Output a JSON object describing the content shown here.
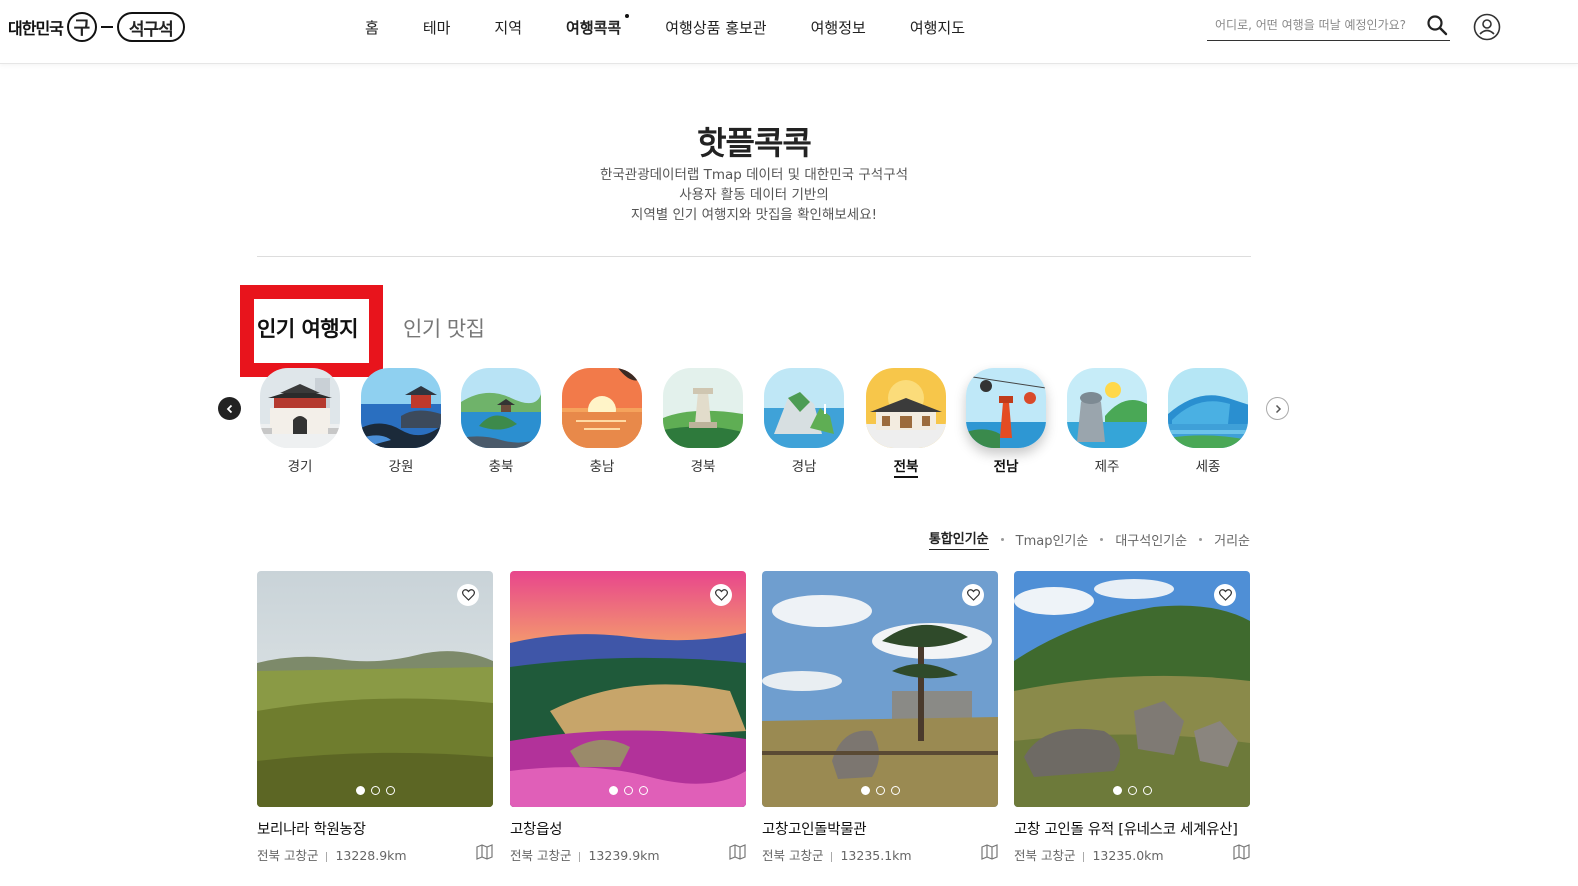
{
  "header": {
    "logo_left": "대한민국",
    "logo_mark": "구",
    "logo_right": "석구석",
    "nav": [
      "홈",
      "테마",
      "지역",
      "여행콕콕",
      "여행상품 홍보관",
      "여행정보",
      "여행지도"
    ],
    "nav_active_index": 3,
    "search_placeholder": "어디로, 어떤 여행을 떠날 예정인가요?"
  },
  "hero": {
    "title": "핫플콕콕",
    "desc_lines": [
      "한국관광데이터랩 Tmap 데이터 및 대한민국 구석구석",
      "사용자 활동 데이터 기반의",
      "지역별 인기 여행지와 맛집을 확인해보세요!"
    ]
  },
  "tabs": {
    "popular": "인기 여행지",
    "food": "인기 맛집"
  },
  "regions": [
    {
      "label": "경기",
      "icon": "fortress-gate-icon"
    },
    {
      "label": "강원",
      "icon": "seaside-pavilion-icon"
    },
    {
      "label": "충북",
      "icon": "lake-island-icon"
    },
    {
      "label": "충남",
      "icon": "sunset-sea-icon"
    },
    {
      "label": "경북",
      "icon": "stone-tower-icon"
    },
    {
      "label": "경남",
      "icon": "island-cliff-icon"
    },
    {
      "label": "전북",
      "icon": "hanok-village-icon"
    },
    {
      "label": "전남",
      "icon": "cable-car-tower-icon"
    },
    {
      "label": "제주",
      "icon": "dol-hareubang-icon"
    },
    {
      "label": "세종",
      "icon": "modern-building-icon"
    }
  ],
  "regions_selected": "전북",
  "sort": [
    "통합인기순",
    "Tmap인기순",
    "대구석인기순",
    "거리순"
  ],
  "cards": [
    {
      "title": "보리나라 학원농장",
      "region": "전북 고창군",
      "distance": "13228.9km"
    },
    {
      "title": "고창읍성",
      "region": "전북 고창군",
      "distance": "13239.9km"
    },
    {
      "title": "고창고인돌박물관",
      "region": "전북 고창군",
      "distance": "13235.1km"
    },
    {
      "title": "고창 고인돌 유적 [유네스코 세계유산]",
      "region": "전북 고창군",
      "distance": "13235.0km"
    }
  ]
}
